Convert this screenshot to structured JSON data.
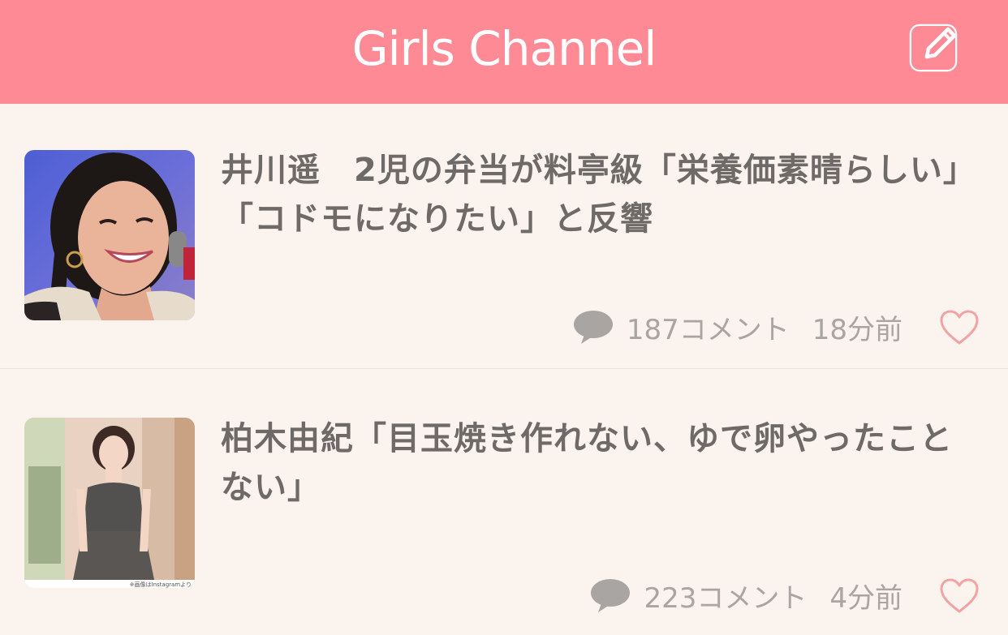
{
  "header": {
    "title": "Girls Channel",
    "compose_icon": "compose-icon",
    "background_color": "#fd8a94"
  },
  "topics": [
    {
      "title": "井川遥　2児の弁当が料亭級「栄養価素晴らしい」「コドモになりたい」と反響",
      "comments": "187コメント",
      "time": "18分前",
      "comment_icon": "speech-bubble-icon",
      "favorite_icon": "heart-outline-icon"
    },
    {
      "title": "柏木由紀「目玉焼き作れない、ゆで卵やったことない」",
      "comments": "223コメント",
      "time": "4分前",
      "comment_icon": "speech-bubble-icon",
      "favorite_icon": "heart-outline-icon",
      "thumbnail_credit": "※画像はInstagramより"
    }
  ],
  "colors": {
    "accent": "#fd8a94",
    "background": "#faf3ee",
    "title_text": "#6e6a67",
    "meta_text": "#a9a5a2",
    "heart": "#f3a3a3"
  }
}
